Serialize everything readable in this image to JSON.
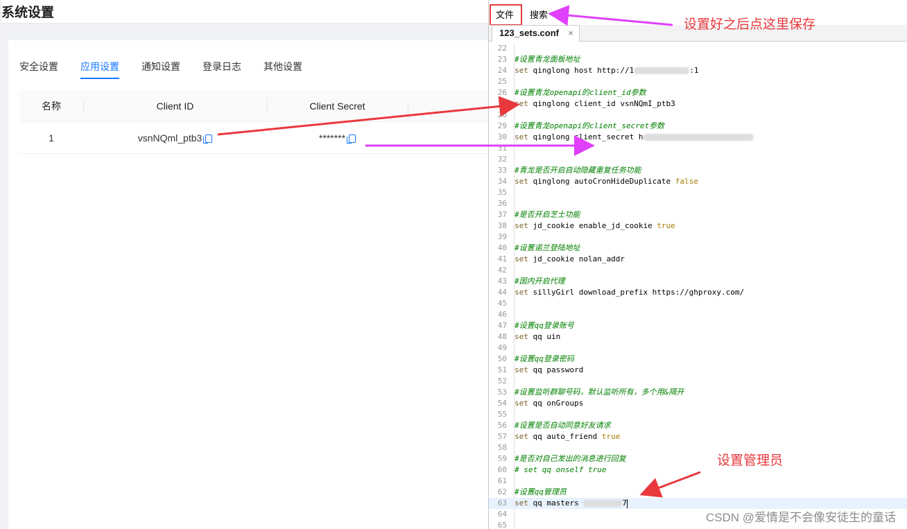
{
  "left_panel": {
    "title": "系统设置",
    "tabs": [
      {
        "label": "安全设置",
        "active": false
      },
      {
        "label": "应用设置",
        "active": true
      },
      {
        "label": "通知设置",
        "active": false
      },
      {
        "label": "登录日志",
        "active": false
      },
      {
        "label": "其他设置",
        "active": false
      }
    ],
    "table": {
      "headers": [
        "名称",
        "Client ID",
        "Client Secret"
      ],
      "rows": [
        {
          "name": "1",
          "client_id": "vsnNQml_ptb3",
          "client_secret": "*******"
        }
      ]
    }
  },
  "editor": {
    "menu": {
      "file": "文件",
      "search": "搜索"
    },
    "file_tab": {
      "name": "123_sets.conf",
      "close": "×"
    },
    "lines": [
      {
        "n": "22",
        "text": "",
        "type": "plain"
      },
      {
        "n": "23",
        "text": "#设置青龙面板地址",
        "type": "comment"
      },
      {
        "n": "24",
        "text": "set qinglong host http://1",
        "suffix": ":1",
        "type": "cmd",
        "blur": true
      },
      {
        "n": "25",
        "text": "",
        "type": "plain"
      },
      {
        "n": "26",
        "text": "#设置青龙openapi的client_id参数",
        "type": "comment"
      },
      {
        "n": "27",
        "text": "set qinglong client_id vsnNQmI_ptb3",
        "type": "cmd"
      },
      {
        "n": "28",
        "text": "",
        "type": "plain"
      },
      {
        "n": "29",
        "text": "#设置青龙openapi的client_secret参数",
        "type": "comment"
      },
      {
        "n": "30",
        "text": "set qinglong client_secret h",
        "type": "cmd",
        "blur": true
      },
      {
        "n": "31",
        "text": "",
        "type": "plain"
      },
      {
        "n": "32",
        "text": "",
        "type": "plain"
      },
      {
        "n": "33",
        "text": "#青龙是否开启自动隐藏重复任务功能",
        "type": "comment"
      },
      {
        "n": "34",
        "text": "set qinglong autoCronHideDuplicate ",
        "bool": "false",
        "type": "cmd"
      },
      {
        "n": "35",
        "text": "",
        "type": "plain"
      },
      {
        "n": "36",
        "text": "",
        "type": "plain"
      },
      {
        "n": "37",
        "text": "#是否开启芝士功能",
        "type": "comment"
      },
      {
        "n": "38",
        "text": "set jd_cookie enable_jd_cookie ",
        "bool": "true",
        "type": "cmd"
      },
      {
        "n": "39",
        "text": "",
        "type": "plain"
      },
      {
        "n": "40",
        "text": "#设置诺兰登陆地址",
        "type": "comment"
      },
      {
        "n": "41",
        "text": "set jd_cookie nolan_addr",
        "type": "cmd"
      },
      {
        "n": "42",
        "text": "",
        "type": "plain"
      },
      {
        "n": "43",
        "text": "#国内开启代理",
        "type": "comment"
      },
      {
        "n": "44",
        "text": "set sillyGirl download_prefix https://ghproxy.com/",
        "type": "cmd"
      },
      {
        "n": "45",
        "text": "",
        "type": "plain"
      },
      {
        "n": "46",
        "text": "",
        "type": "plain"
      },
      {
        "n": "47",
        "text": "#设置qq登录账号",
        "type": "comment"
      },
      {
        "n": "48",
        "text": "set qq uin",
        "type": "cmd"
      },
      {
        "n": "49",
        "text": "",
        "type": "plain"
      },
      {
        "n": "50",
        "text": "#设置qq登录密码",
        "type": "comment"
      },
      {
        "n": "51",
        "text": "set qq password",
        "type": "cmd"
      },
      {
        "n": "52",
        "text": "",
        "type": "plain"
      },
      {
        "n": "53",
        "text": "#设置监听群聊号码，默认监听所有，多个用&隔开",
        "type": "comment"
      },
      {
        "n": "54",
        "text": "set qq onGroups",
        "type": "cmd"
      },
      {
        "n": "55",
        "text": "",
        "type": "plain"
      },
      {
        "n": "56",
        "text": "#设置是否自动同意好友请求",
        "type": "comment"
      },
      {
        "n": "57",
        "text": "set qq auto_friend ",
        "bool": "true",
        "type": "cmd"
      },
      {
        "n": "58",
        "text": "",
        "type": "plain"
      },
      {
        "n": "59",
        "text": "#是否对自己发出的消息进行回复",
        "type": "comment"
      },
      {
        "n": "60",
        "text": "# set qq onself true",
        "type": "comment"
      },
      {
        "n": "61",
        "text": "",
        "type": "plain"
      },
      {
        "n": "62",
        "text": "#设置qq管理员",
        "type": "comment"
      },
      {
        "n": "63",
        "text": "set qq masters ",
        "suffix": "7",
        "type": "cmd",
        "blur": true,
        "current": true
      },
      {
        "n": "64",
        "text": "",
        "type": "plain"
      },
      {
        "n": "65",
        "text": "",
        "type": "plain"
      }
    ]
  },
  "annotations": {
    "save_note": "设置好之后点这里保存",
    "admin_note": "设置管理员",
    "watermark": "CSDN @爱情是不会像安徒生的童话",
    "colors": {
      "red": "#e8383d",
      "magenta": "#e040fb",
      "accent": "#1677ff"
    }
  }
}
